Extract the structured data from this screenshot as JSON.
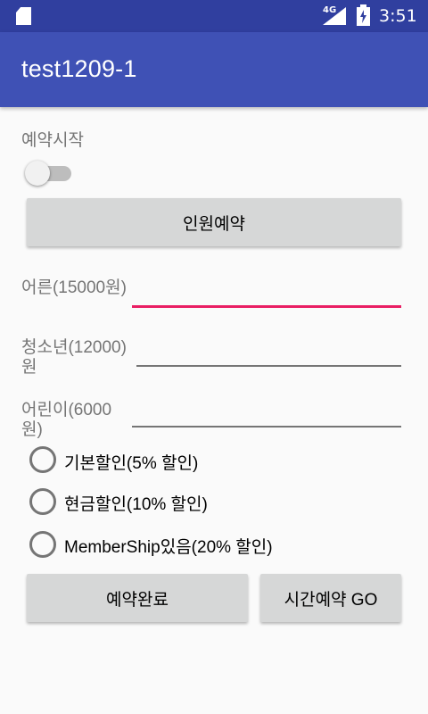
{
  "status_bar": {
    "network": "4G",
    "time": "3:51"
  },
  "app_bar": {
    "title": "test1209-1"
  },
  "reservation": {
    "start_label": "예약시작",
    "switch_on": false,
    "people_button": "인원예약"
  },
  "fields": {
    "adult": {
      "label": "어른(15000원)",
      "value": ""
    },
    "teen": {
      "label": "청소년(12000)원",
      "value": ""
    },
    "child": {
      "label": "어린이(6000원)",
      "value": ""
    }
  },
  "discounts": [
    {
      "label": "기본할인(5% 할인)",
      "selected": false
    },
    {
      "label": "현금할인(10% 할인)",
      "selected": false
    },
    {
      "label": "MemberShip있음(20% 할인)",
      "selected": false
    }
  ],
  "actions": {
    "complete_button": "예약완료",
    "time_button": "시간예약 GO"
  },
  "colors": {
    "status_bar": "#303f9f",
    "app_bar": "#3f51b5",
    "accent": "#e91e63",
    "button": "#d6d7d7"
  }
}
